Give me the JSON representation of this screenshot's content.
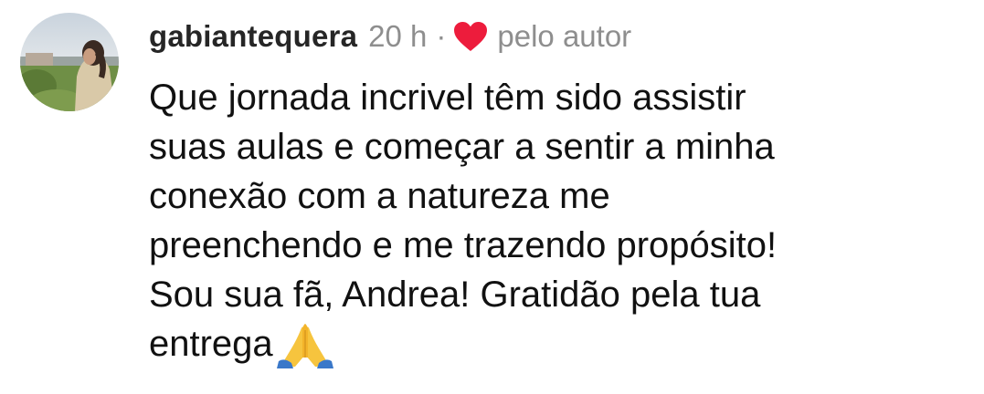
{
  "comment": {
    "username": "gabiantequera",
    "timestamp": "20 h",
    "separator": "·",
    "liked_icon": "heart-icon",
    "liked_color": "#ed1c3c",
    "liked_label": "pelo autor",
    "text_lines": [
      "Que jornada incrivel têm sido assistir",
      "suas aulas e começar a sentir a minha",
      "conexão com a natureza me",
      "preenchendo e me trazendo propósito!",
      "Sou sua fã, Andrea! Gratidão pela tua",
      "entrega"
    ],
    "trailing_emoji": "folded-hands-emoji"
  }
}
